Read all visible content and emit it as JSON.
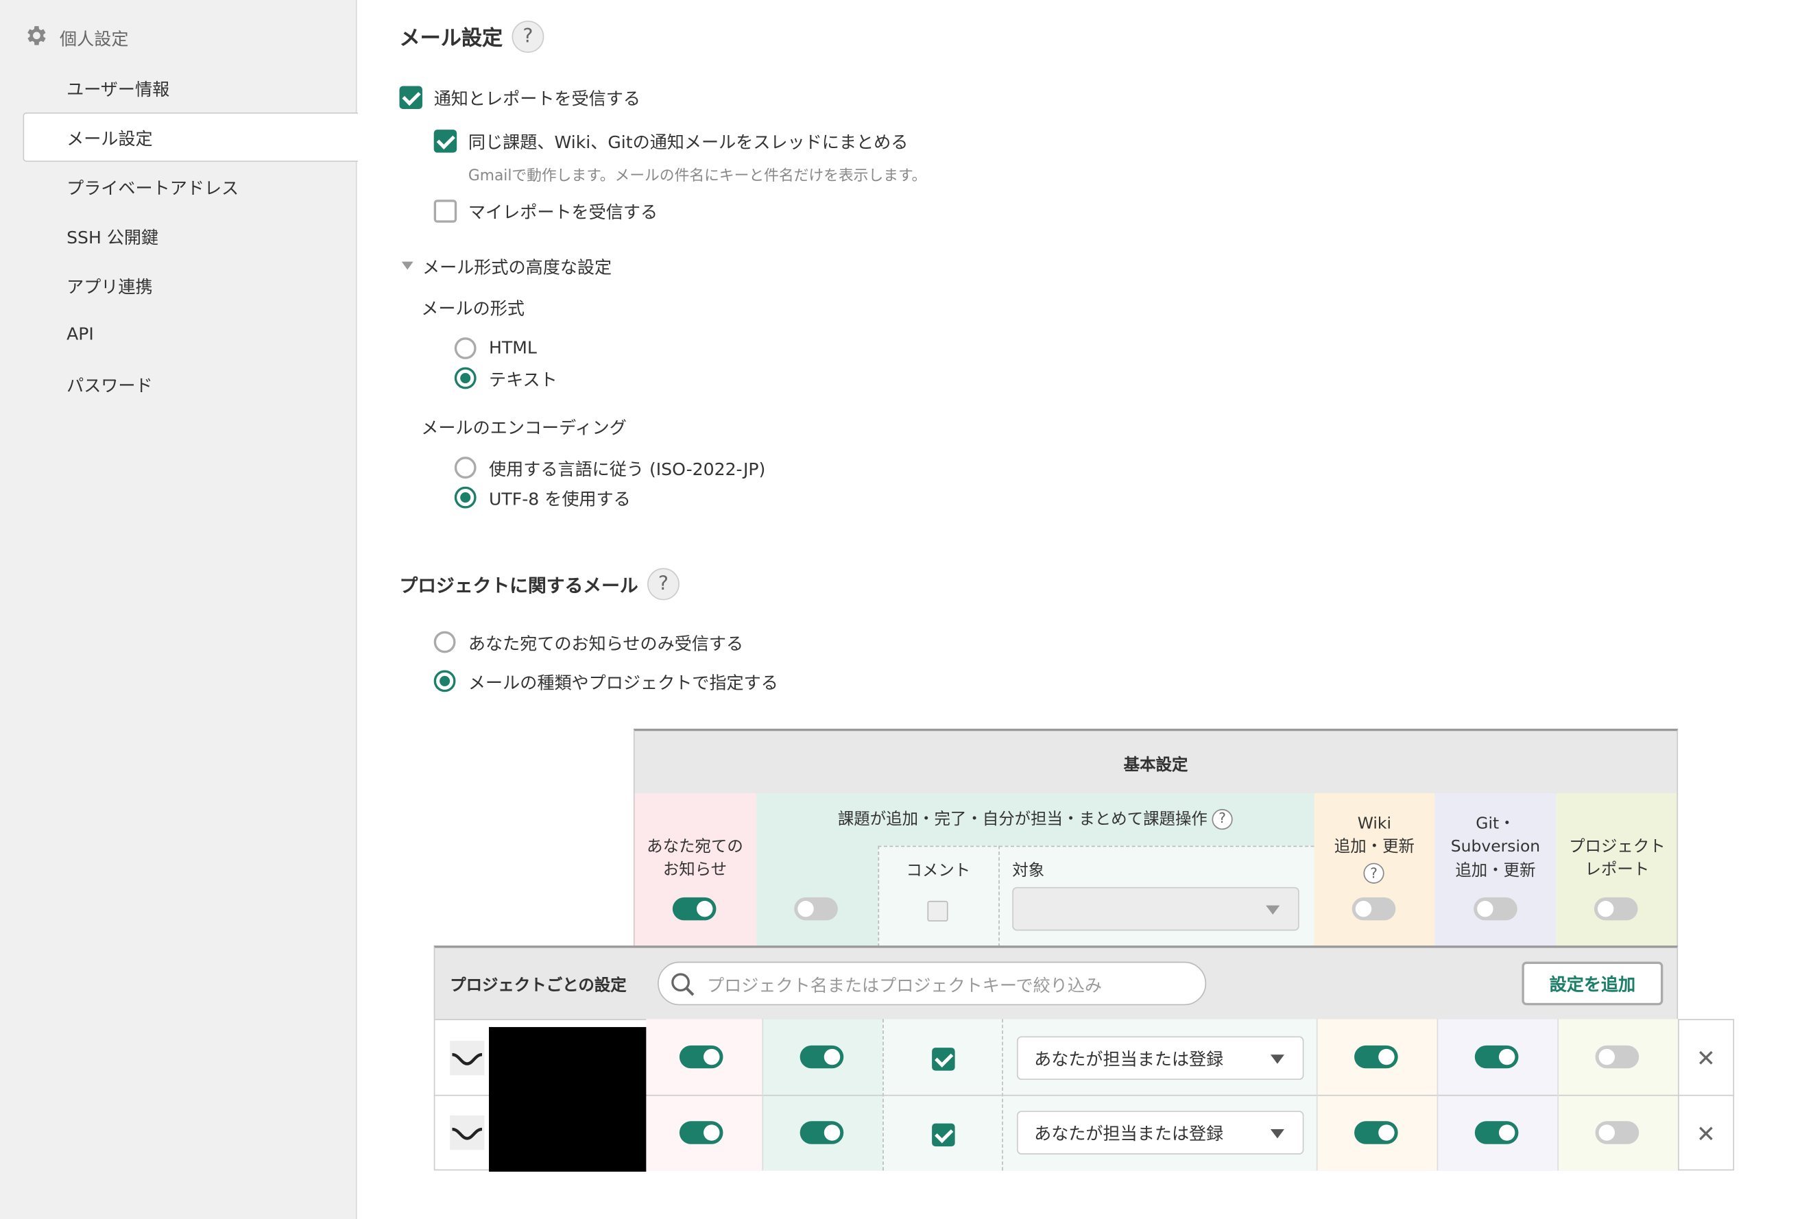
{
  "sidebar": {
    "title": "個人設定",
    "items": [
      {
        "label": "ユーザー情報"
      },
      {
        "label": "メール設定",
        "active": true
      },
      {
        "label": "プライベートアドレス"
      },
      {
        "label": "SSH 公開鍵"
      },
      {
        "label": "アプリ連携"
      },
      {
        "label": "API"
      },
      {
        "label": "パスワード"
      }
    ]
  },
  "mail": {
    "heading": "メール設定",
    "help": "?",
    "receive_notify": {
      "label": "通知とレポートを受信する",
      "checked": true
    },
    "thread": {
      "label": "同じ課題、Wiki、Gitの通知メールをスレッドにまとめる",
      "checked": true,
      "note": "Gmailで動作します。メールの件名にキーと件名だけを表示します。"
    },
    "my_report": {
      "label": "マイレポートを受信する",
      "checked": false
    },
    "advanced": {
      "title": "メール形式の高度な設定",
      "format_label": "メールの形式",
      "format_options": [
        {
          "label": "HTML",
          "selected": false
        },
        {
          "label": "テキスト",
          "selected": true
        }
      ],
      "encoding_label": "メールのエンコーディング",
      "encoding_options": [
        {
          "label": "使用する言語に従う (ISO-2022-JP)",
          "selected": false
        },
        {
          "label": "UTF-8 を使用する",
          "selected": true
        }
      ]
    }
  },
  "project_mail": {
    "heading": "プロジェクトに関するメール",
    "help": "?",
    "options": [
      {
        "label": "あなた宛てのお知らせのみ受信する",
        "selected": false
      },
      {
        "label": "メールの種類やプロジェクトで指定する",
        "selected": true
      }
    ]
  },
  "table": {
    "basic_title": "基本設定",
    "col_notice": "あなた宛ての\nお知らせ",
    "col_issue": "課題が追加・完了・自分が担当・まとめて課題操作",
    "col_issue_help": "?",
    "col_comment": "コメント",
    "col_target": "対象",
    "col_wiki": "Wiki\n追加・更新",
    "col_wiki_help": "?",
    "col_git": "Git・\nSubversion\n追加・更新",
    "col_report": "プロジェクト\nレポート",
    "default_toggles": {
      "notice": true,
      "issue": false,
      "comment": false,
      "wiki": false,
      "git": false,
      "report": false
    },
    "project_section_label": "プロジェクトごとの設定",
    "search_placeholder": "プロジェクト名またはプロジェクトキーで絞り込み",
    "add_button": "設定を追加",
    "rows": [
      {
        "target": "あなたが担当または登録",
        "notice": true,
        "issue": true,
        "comment": true,
        "wiki": true,
        "git": true,
        "report": false
      },
      {
        "target": "あなたが担当または登録",
        "notice": true,
        "issue": true,
        "comment": true,
        "wiki": true,
        "git": true,
        "report": false
      }
    ]
  },
  "colors": {
    "accent": "#1b7f6a",
    "notice_col": "#fde8ec",
    "issue_col": "#e0f1ec",
    "wiki_col": "#fdf0dc",
    "git_col": "#ebebf5",
    "report_col": "#eff3dc"
  },
  "icons": {
    "sidebar_title": "gear-icon",
    "search": "search-icon",
    "row_toggle": "chevron-down-icon",
    "remove": "close-icon",
    "dropdown": "dropdown-arrow-icon",
    "disclosure": "triangle-down-icon"
  }
}
